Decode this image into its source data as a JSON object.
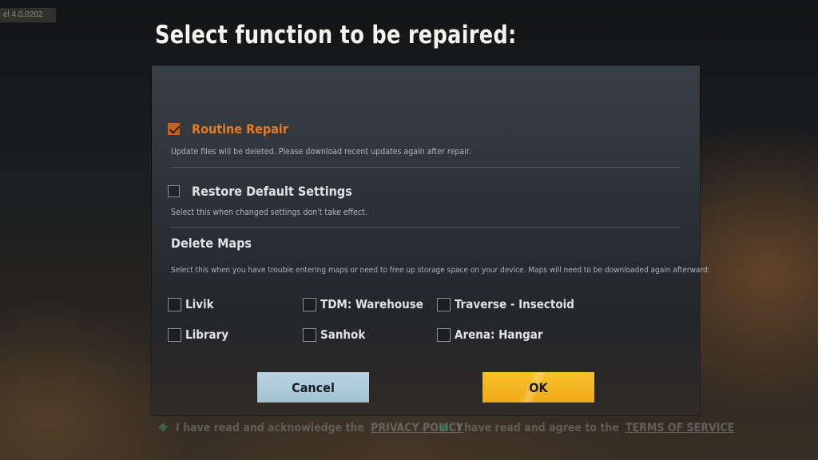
{
  "version_text": "el 4.0.0202",
  "title": "Select function to be repaired:",
  "options": {
    "routine_repair": {
      "label": "Routine Repair",
      "checked": true,
      "description": "Update files will be deleted. Please download recent updates again after repair."
    },
    "restore_default": {
      "label": "Restore Default Settings",
      "checked": false,
      "description": "Select this when changed settings don't take effect."
    }
  },
  "delete_maps": {
    "heading": "Delete Maps",
    "description": "Select this when you have trouble entering maps or need to free up storage space on your device. Maps will need to be downloaded again afterward:",
    "maps": [
      {
        "label": "Livik",
        "checked": false
      },
      {
        "label": "TDM: Warehouse",
        "checked": false
      },
      {
        "label": "Traverse - Insectoid",
        "checked": false
      },
      {
        "label": "Library",
        "checked": false
      },
      {
        "label": "Sanhok",
        "checked": false
      },
      {
        "label": "Arena: Hangar",
        "checked": false
      }
    ]
  },
  "buttons": {
    "cancel": "Cancel",
    "ok": "OK"
  },
  "footer": {
    "privacy_text": "I have read and acknowledge the",
    "privacy_link": "PRIVACY POLICY",
    "terms_text": "I have read and agree to the",
    "terms_link": "TERMS OF SERVICE"
  },
  "colors": {
    "accent_orange": "#e87a22",
    "ok_yellow": "#f7c22a",
    "cancel_blue": "#b9d3e0"
  }
}
